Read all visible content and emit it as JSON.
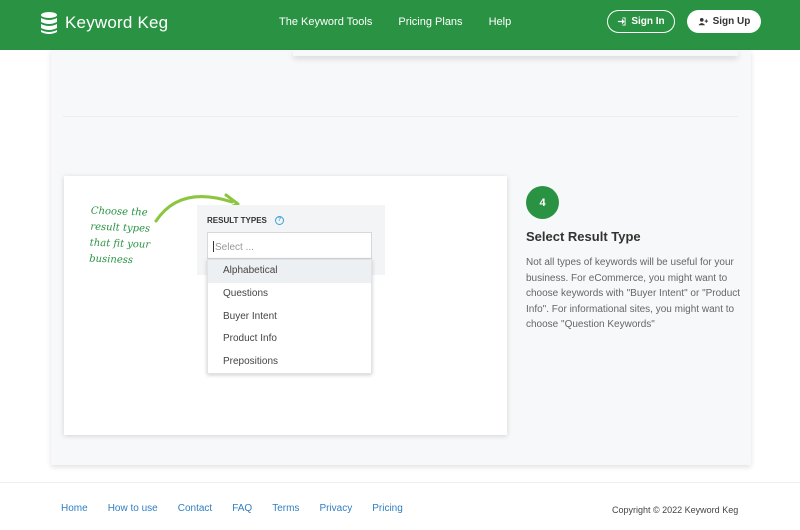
{
  "header": {
    "brand": "Keyword Keg",
    "nav": [
      "The Keyword Tools",
      "Pricing Plans",
      "Help"
    ],
    "sign_in": "Sign In",
    "sign_up": "Sign Up"
  },
  "illustration": {
    "note": "Choose the result types that fit your business",
    "label": "RESULT TYPES",
    "help": "?",
    "placeholder": "Select ...",
    "options": [
      "Alphabetical",
      "Questions",
      "Buyer Intent",
      "Product Info",
      "Prepositions"
    ]
  },
  "step": {
    "number": "4",
    "title": "Select Result Type",
    "description": "Not all types of keywords will be useful for your business. For eCommerce, you might want to choose keywords with \"Buyer Intent\" or \"Product Info\". For informational sites, you might want to choose \"Question Keywords\""
  },
  "footer": {
    "links": [
      "Home",
      "How to use",
      "Contact",
      "FAQ",
      "Terms",
      "Privacy",
      "Pricing"
    ],
    "copyright": "Copyright © 2022 Keyword Keg"
  },
  "colors": {
    "brand_green": "#2a9343",
    "link_blue": "#2f7fc1"
  }
}
